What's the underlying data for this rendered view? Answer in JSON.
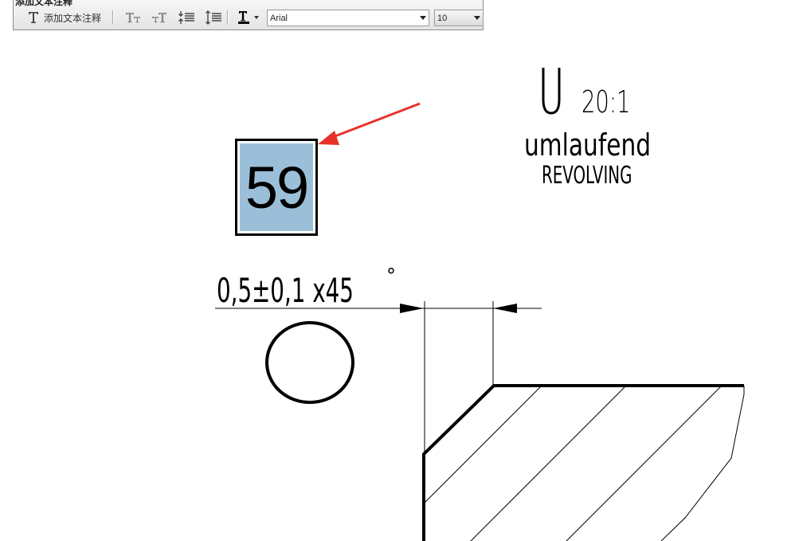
{
  "toolbar": {
    "title": "添加文本注释",
    "add_text_label": "添加文本注释",
    "font_name": "Arial",
    "font_size": "10",
    "icons": [
      "text-t-icon",
      "font-size-decrease-icon",
      "font-size-increase-icon",
      "line-spacing-decrease-icon",
      "line-spacing-increase-icon",
      "text-color-icon"
    ]
  },
  "callout": {
    "number": "59",
    "fill_color": "#9cbfd9",
    "arrow_color": "#e8302a"
  },
  "drawing": {
    "detail_letter": "U",
    "scale": "20:1",
    "note_de": "umlaufend",
    "note_en": "REVOLVING",
    "chamfer_dimension": "0,5±0,1 x45",
    "degree_mark": "°"
  }
}
